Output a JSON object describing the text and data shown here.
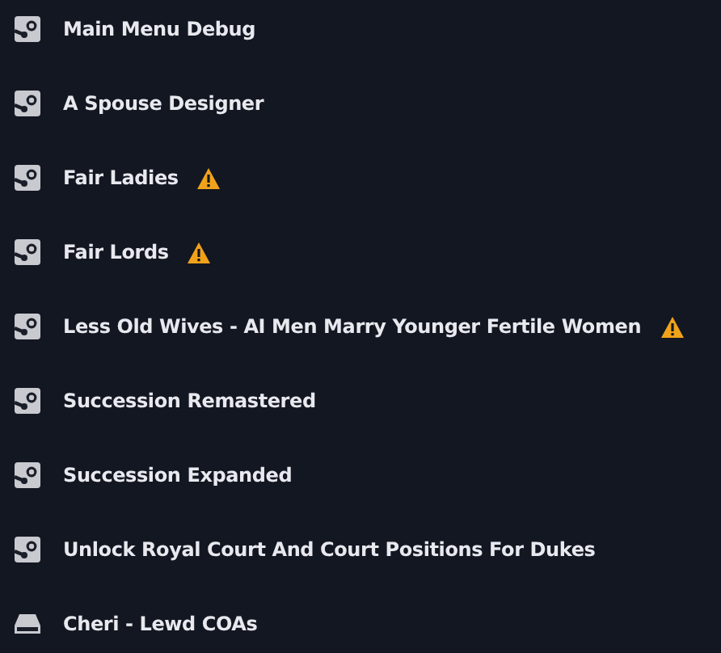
{
  "mods": [
    {
      "name": "Main Menu Debug",
      "kind": "steam",
      "warning": false
    },
    {
      "name": "A Spouse Designer",
      "kind": "steam",
      "warning": false
    },
    {
      "name": "Fair Ladies",
      "kind": "steam",
      "warning": true
    },
    {
      "name": "Fair Lords",
      "kind": "steam",
      "warning": true
    },
    {
      "name": "Less Old Wives - AI Men Marry Younger Fertile Women",
      "kind": "steam",
      "warning": true
    },
    {
      "name": "Succession Remastered",
      "kind": "steam",
      "warning": false
    },
    {
      "name": "Succession Expanded",
      "kind": "steam",
      "warning": false
    },
    {
      "name": "Unlock Royal Court And Court Positions For Dukes",
      "kind": "steam",
      "warning": false
    },
    {
      "name": "Cheri - Lewd COAs",
      "kind": "local",
      "warning": false
    }
  ]
}
